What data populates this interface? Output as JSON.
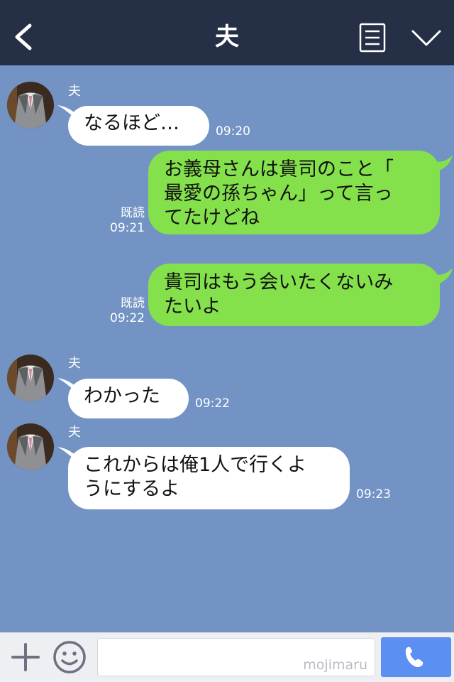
{
  "header": {
    "title": "夫",
    "back_icon": "chevron-left-icon",
    "memo_icon": "note-list-icon",
    "menu_icon": "chevron-down-icon"
  },
  "messages": [
    {
      "sender": "夫",
      "text": "なるほど…",
      "time": "09:20"
    },
    {
      "read": "既読",
      "time": "09:21",
      "lines": [
        "お義母さんは貴司のこと「",
        "最愛の孫ちゃん」って言っ",
        "てたけどね"
      ]
    },
    {
      "read": "既読",
      "time": "09:22",
      "lines": [
        "貴司はもう会いたくないみ",
        "たいよ"
      ]
    },
    {
      "sender": "夫",
      "text": "わかった",
      "time": "09:22"
    },
    {
      "sender": "夫",
      "lines": [
        "これからは俺1人で行くよ",
        "うにするよ"
      ],
      "time": "09:23"
    }
  ],
  "input_bar": {
    "placeholder": "",
    "watermark": "mojimaru",
    "plus_icon": "plus-icon",
    "emoji_icon": "smiley-icon",
    "call_icon": "phone-icon"
  },
  "colors": {
    "header_bg": "#252f45",
    "chat_bg": "#7393c4",
    "outgoing_bubble": "#84e14b",
    "incoming_bubble": "#ffffff",
    "call_button": "#5b8ff1"
  }
}
